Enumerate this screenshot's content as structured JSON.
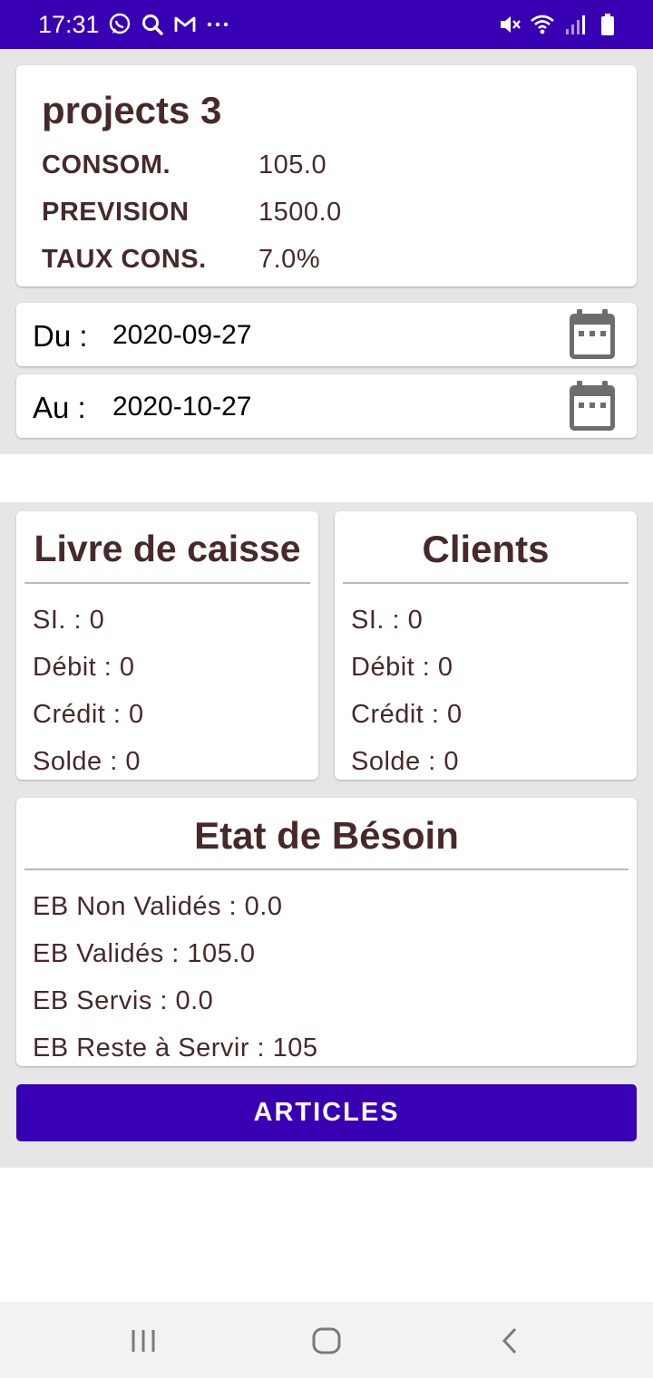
{
  "status_bar": {
    "time": "17:31",
    "left_icons": [
      "whatsapp-icon",
      "search-icon",
      "gmail-icon",
      "more-icon"
    ],
    "right_icons": [
      "mute-icon",
      "wifi-icon",
      "signal-icon",
      "battery-icon"
    ]
  },
  "summary": {
    "title": "projects 3",
    "rows": [
      {
        "label": "CONSOM.",
        "value": "105.0"
      },
      {
        "label": "PREVISION",
        "value": "1500.0"
      },
      {
        "label": "TAUX CONS.",
        "value": "7.0%"
      }
    ]
  },
  "dates": {
    "from_label": "Du :",
    "from_value": "2020-09-27",
    "to_label": "Au :",
    "to_value": "2020-10-27"
  },
  "livre_de_caisse": {
    "title": "Livre de caisse",
    "lines": [
      "SI. :  0",
      "Débit :  0",
      "Crédit :  0",
      "Solde :  0"
    ]
  },
  "clients": {
    "title": "Clients",
    "lines": [
      "SI. :  0",
      "Débit :  0",
      "Crédit :  0",
      "Solde :  0"
    ]
  },
  "etat_de_besoin": {
    "title": "Etat de Bésoin",
    "lines": [
      "EB Non Validés :  0.0",
      "EB Validés :  105.0",
      "EB Servis :  0.0",
      "EB Reste à Servir :  105"
    ]
  },
  "articles_button": "ARTICLES",
  "nav_bar": [
    "recent-apps-icon",
    "home-icon",
    "back-icon"
  ]
}
